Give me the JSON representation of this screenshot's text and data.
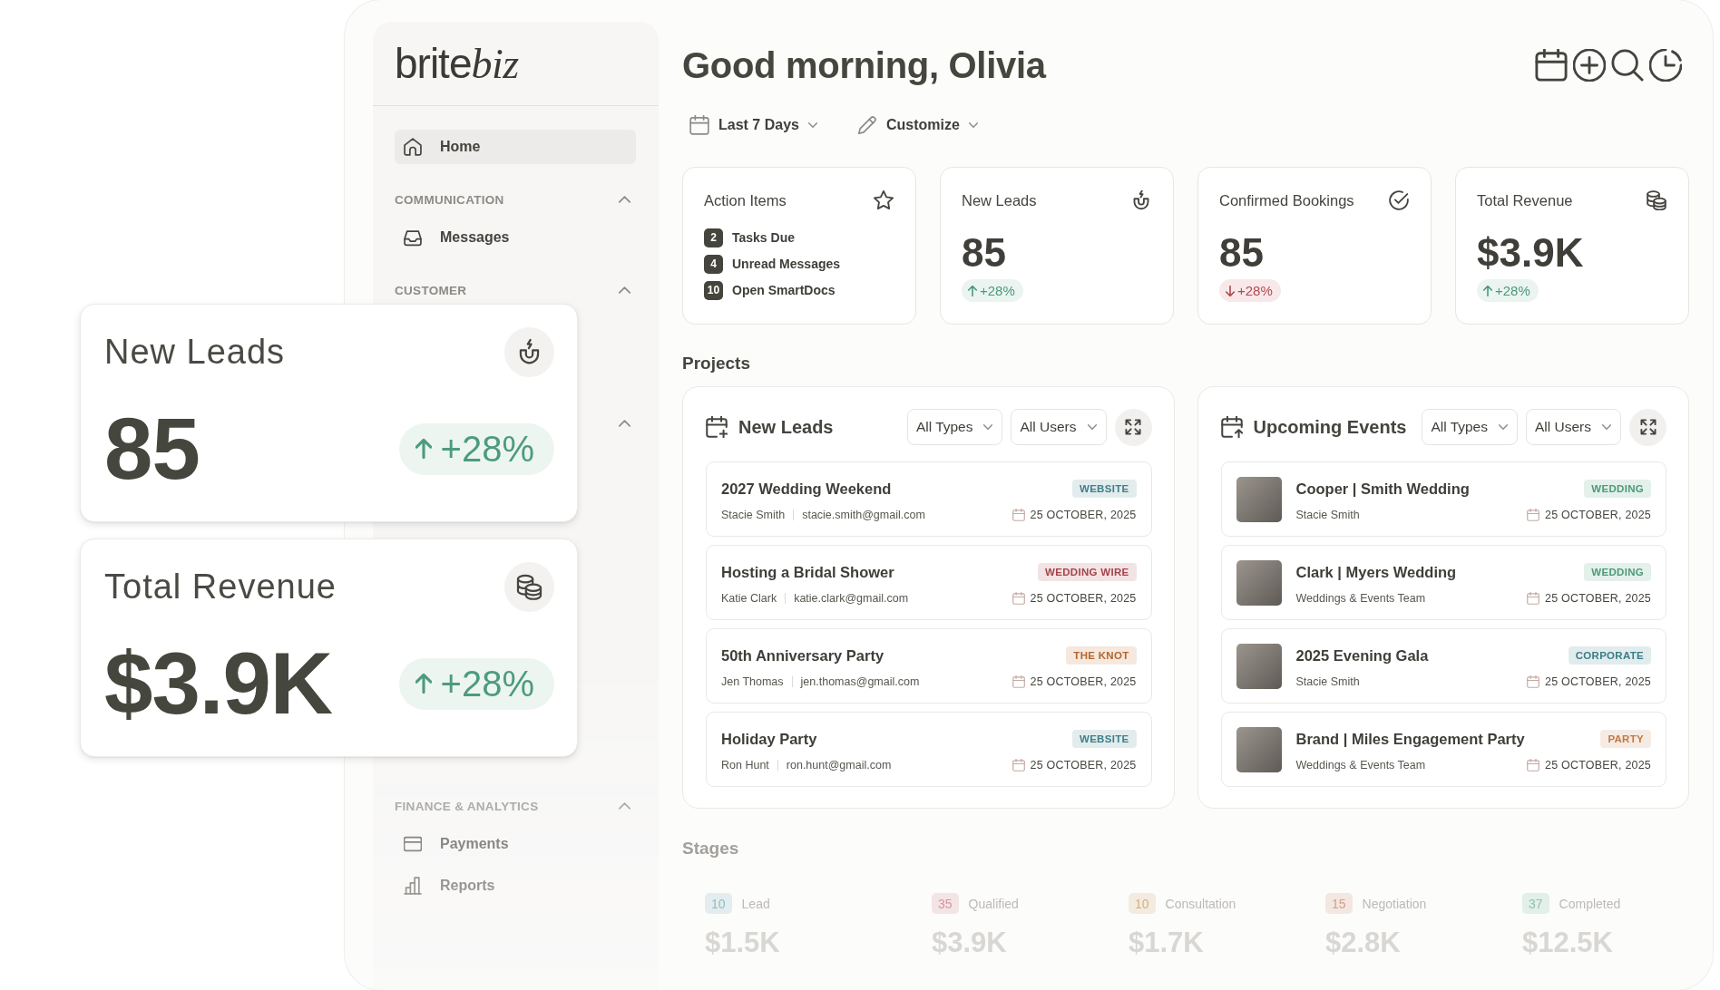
{
  "sidebar": {
    "logo": [
      {
        "kind": "sans",
        "text": "brite"
      },
      {
        "kind": "script",
        "text": "biz"
      }
    ],
    "items": [
      {
        "label": "Home",
        "selected": true
      }
    ],
    "sections": [
      {
        "title": "COMMUNICATION",
        "expanded": true,
        "items": [
          {
            "label": "Messages",
            "selected": false
          }
        ]
      },
      {
        "title": "CUSTOMER",
        "expanded": true
      },
      {
        "expanded": true
      },
      {
        "title": "FINANCE & ANALYTICS",
        "expanded": true,
        "items": [
          {
            "label": "Payments",
            "selected": false
          },
          {
            "label": "Reports",
            "selected": false
          }
        ]
      }
    ]
  },
  "header": {
    "title": "Good morning, Olivia",
    "filters": [
      {
        "label": "Last 7 Days"
      },
      {
        "label": "Customize"
      }
    ]
  },
  "stat_cards": [
    {
      "kind": "list",
      "title": "Action Items",
      "items": [
        {
          "count": "2",
          "label": "Tasks Due"
        },
        {
          "count": "4",
          "label": "Unread Messages"
        },
        {
          "count": "10",
          "label": "Open SmartDocs"
        }
      ]
    },
    {
      "kind": "metric",
      "title": "New Leads",
      "value": "85",
      "change": "+28%",
      "increase": true
    },
    {
      "kind": "metric",
      "title": "Confirmed Bookings",
      "value": "85",
      "change": "+28%",
      "increase": false
    },
    {
      "kind": "metric",
      "title": "Total Revenue",
      "value": "$3.9K",
      "change": "+28%",
      "increase": true
    }
  ],
  "projects": {
    "title": "Projects",
    "panels": [
      {
        "kind": "leads",
        "title": "New Leads",
        "filters": [
          "All Types",
          "All Users"
        ],
        "items": [
          {
            "title": "2027 Wedding Weekend",
            "contact": "Stacie Smith",
            "email": "stacie.smith@gmail.com",
            "tag": {
              "label": "WEBSITE",
              "color": "#3f7f89"
            },
            "date": "25 OCTOBER, 2025"
          },
          {
            "title": "Hosting a Bridal Shower",
            "contact": "Katie Clark",
            "email": "katie.clark@gmail.com",
            "tag": {
              "label": "WEDDING WIRE",
              "color": "#a6434b"
            },
            "date": "25 OCTOBER, 2025"
          },
          {
            "title": "50th Anniversary Party",
            "contact": "Jen Thomas",
            "email": "jen.thomas@gmail.com",
            "tag": {
              "label": "THE KNOT",
              "color": "#b4652b"
            },
            "date": "25 OCTOBER, 2025"
          },
          {
            "title": "Holiday Party",
            "contact": "Ron Hunt",
            "email": "ron.hunt@gmail.com",
            "tag": {
              "label": "WEBSITE",
              "color": "#3f7f89"
            },
            "date": "25 OCTOBER, 2025"
          }
        ]
      },
      {
        "kind": "events",
        "title": "Upcoming Events",
        "filters": [
          "All Types",
          "All Users"
        ],
        "items": [
          {
            "title": "Cooper | Smith Wedding",
            "contact": "Stacie Smith",
            "tag": {
              "label": "WEDDING",
              "color": "#4d9a77"
            },
            "date": "25 OCTOBER, 2025"
          },
          {
            "title": "Clark | Myers Wedding",
            "contact": "Weddings & Events Team",
            "tag": {
              "label": "WEDDING",
              "color": "#4d9a77"
            },
            "date": "25 OCTOBER, 2025"
          },
          {
            "title": "2025 Evening Gala",
            "contact": "Stacie Smith",
            "tag": {
              "label": "CORPORATE",
              "color": "#3a7d86"
            },
            "date": "25 OCTOBER, 2025"
          },
          {
            "title": "Brand | Miles Engagement Party",
            "contact": "Weddings & Events Team",
            "tag": {
              "label": "PARTY",
              "color": "#c07a45"
            },
            "date": "25 OCTOBER, 2025"
          }
        ]
      }
    ]
  },
  "stages": {
    "title": "Stages",
    "items": [
      {
        "count": "10",
        "label": "Lead",
        "amount": "$1.5K",
        "color": "#8fbcc3"
      },
      {
        "count": "35",
        "label": "Qualified",
        "amount": "$3.9K",
        "color": "#d6959d"
      },
      {
        "count": "10",
        "label": "Consultation",
        "amount": "$1.7K",
        "color": "#d4b07f"
      },
      {
        "count": "15",
        "label": "Negotiation",
        "amount": "$2.8K",
        "color": "#d59f88"
      },
      {
        "count": "37",
        "label": "Completed",
        "amount": "$12.5K",
        "color": "#8fc3aa"
      }
    ]
  },
  "highlight_cards": [
    {
      "title": "New Leads",
      "value": "85",
      "change": "+28%",
      "increase": true
    },
    {
      "title": "Total Revenue",
      "value": "$3.9K",
      "change": "+28%",
      "increase": true
    }
  ]
}
